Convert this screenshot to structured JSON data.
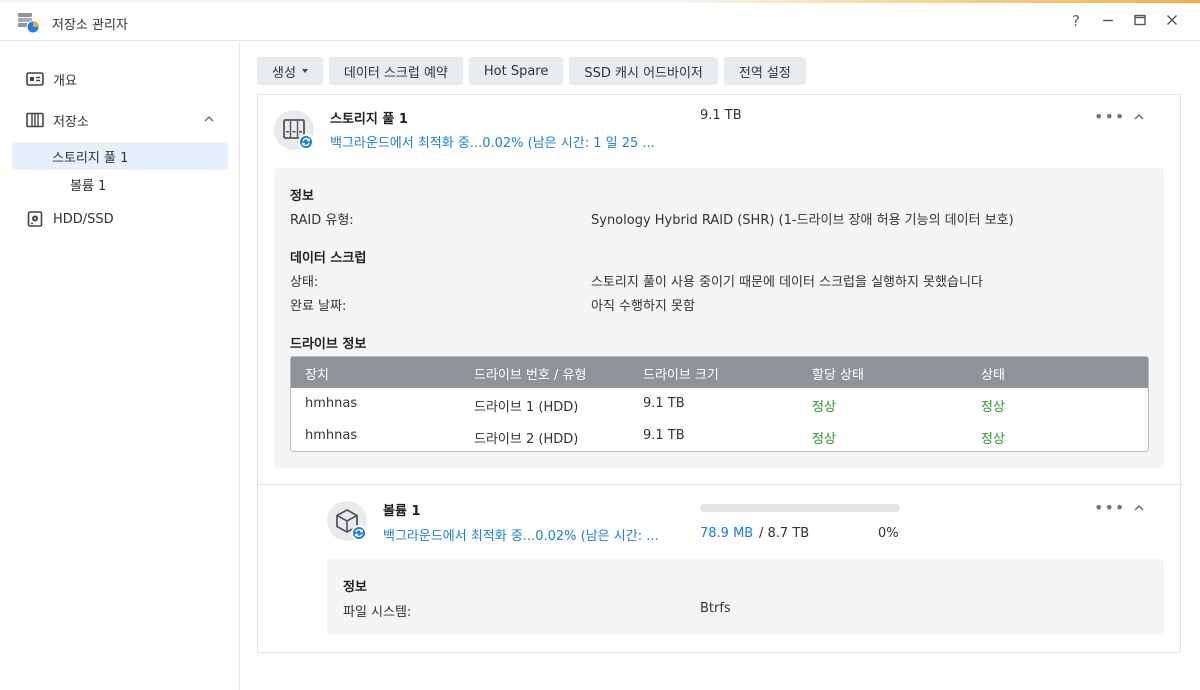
{
  "window": {
    "title": "저장소 관리자",
    "controls": {
      "help": "?",
      "minimize": "—",
      "maximize": "▭",
      "close": "✕"
    }
  },
  "sidebar": {
    "items": [
      {
        "label": "개요",
        "icon": "overview-icon"
      },
      {
        "label": "저장소",
        "icon": "storage-icon"
      },
      {
        "label": "스토리지 풀 1",
        "icon": ""
      },
      {
        "label": "볼륨 1",
        "icon": ""
      },
      {
        "label": "HDD/SSD",
        "icon": "hdd-icon"
      }
    ]
  },
  "toolbar": {
    "create": "생성",
    "scrub_schedule": "데이터 스크럽 예약",
    "hot_spare": "Hot Spare",
    "ssd_cache_advisor": "SSD 캐시 어드바이저",
    "global_settings": "전역 설정"
  },
  "pool": {
    "name": "스토리지 풀 1",
    "status": "백그라운드에서 최적화 중...0.02% (남은 시간: 1 일 25 ...",
    "size": "9.1 TB",
    "info_title": "정보",
    "raid_label": "RAID 유형:",
    "raid_value": "Synology Hybrid RAID (SHR) (1-드라이브 장애 허용 기능의 데이터 보호)",
    "scrub_title": "데이터 스크럽",
    "scrub_status_label": "상태:",
    "scrub_status_value": "스토리지 풀이 사용 중이기 때문에 데이터 스크럽을 실행하지 못했습니다",
    "scrub_date_label": "완료 날짜:",
    "scrub_date_value": "아직 수행하지 못함",
    "drive_title": "드라이브 정보",
    "drive_table": {
      "headers": [
        "장치",
        "드라이브 번호 / 유형",
        "드라이브 크기",
        "할당 상태",
        "상태"
      ],
      "rows": [
        [
          "hmhnas",
          "드라이브 1 (HDD)",
          "9.1 TB",
          "정상",
          "정상"
        ],
        [
          "hmhnas",
          "드라이브 2 (HDD)",
          "9.1 TB",
          "정상",
          "정상"
        ]
      ]
    }
  },
  "volume": {
    "name": "볼륨 1",
    "status": "백그라운드에서 최적화 중...0.02% (남은 시간: ...",
    "used": "78.9 MB",
    "total": "/ 8.7 TB",
    "percent": "0%",
    "usage_fraction": 0.0,
    "info_title": "정보",
    "fs_label": "파일 시스템:",
    "fs_value": "Btrfs"
  },
  "colors": {
    "accent": "#1a7fe0",
    "ok": "#2a9a2a",
    "table_header": "#8d9399",
    "active_nav": "#e5f0fb"
  }
}
